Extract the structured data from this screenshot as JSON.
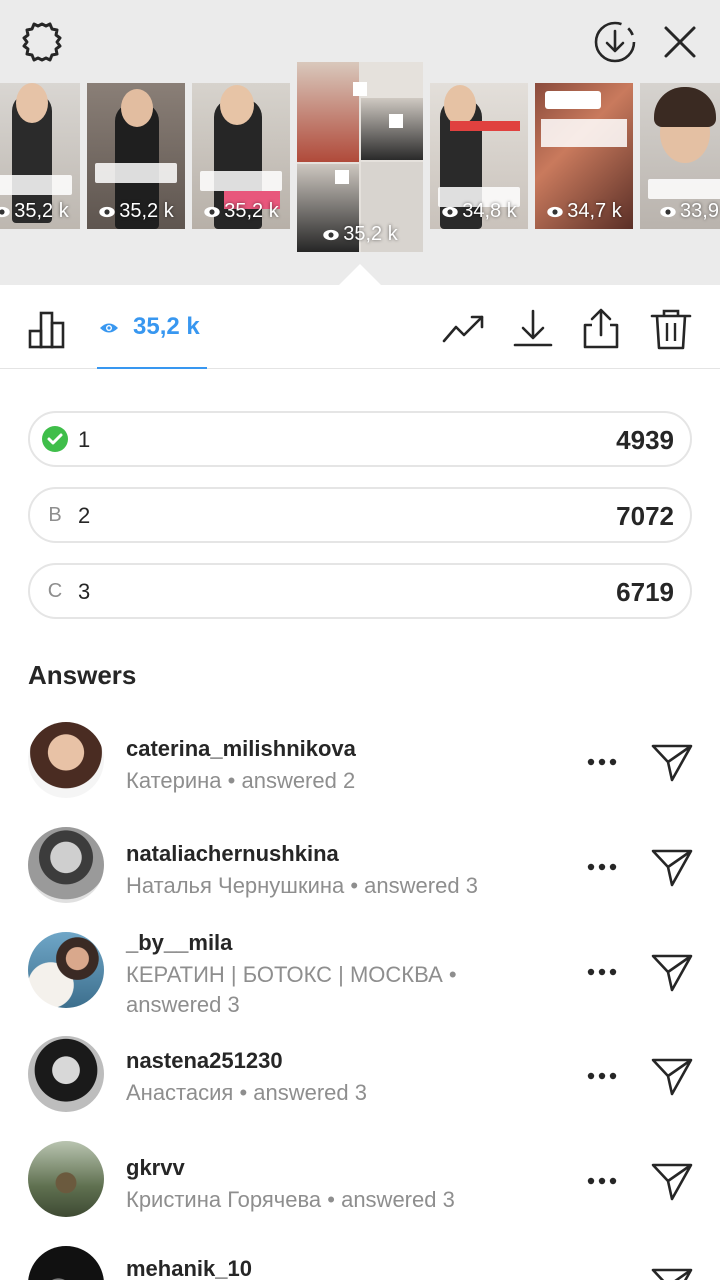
{
  "top_bar": {
    "settings_icon": "gear-icon",
    "download_icon": "download-circle-icon",
    "close_icon": "close-icon"
  },
  "stories": [
    {
      "views": "35,2 k"
    },
    {
      "views": "35,2 k"
    },
    {
      "views": "35,2 k"
    },
    {
      "views": "35,2 k",
      "selected": true
    },
    {
      "views": "34,8 k"
    },
    {
      "views": "34,7 k"
    },
    {
      "views": "33,9"
    }
  ],
  "toolbar": {
    "insights_icon": "bar-chart-icon",
    "views_count": "35,2 k",
    "promote_icon": "trending-up-icon",
    "save_icon": "download-icon",
    "share_icon": "share-icon",
    "delete_icon": "trash-icon"
  },
  "poll": {
    "options": [
      {
        "badge": "",
        "label": "1",
        "count": "4939",
        "correct": true
      },
      {
        "badge": "B",
        "label": "2",
        "count": "7072",
        "correct": false
      },
      {
        "badge": "C",
        "label": "3",
        "count": "6719",
        "correct": false
      }
    ]
  },
  "answers": {
    "title": "Answers",
    "items": [
      {
        "username": "caterina_milishnikova",
        "sub": "Катерина • answered 2"
      },
      {
        "username": "nataliachernushkina",
        "sub": "Наталья Чернушкина • answered 3"
      },
      {
        "username": "_by__mila",
        "sub": "КЕРАТИН | БОТОКС | МОСКВА • answered 3"
      },
      {
        "username": "nastena251230",
        "sub": "Анастасия • answered 3"
      },
      {
        "username": "gkrvv",
        "sub": "Кристина Горячева • answered 3"
      },
      {
        "username": "mehanik_10",
        "sub": ""
      }
    ]
  },
  "colors": {
    "accent": "#3897f0",
    "check": "#3fbe4a",
    "muted": "#8e8e8e",
    "text": "#262626"
  }
}
